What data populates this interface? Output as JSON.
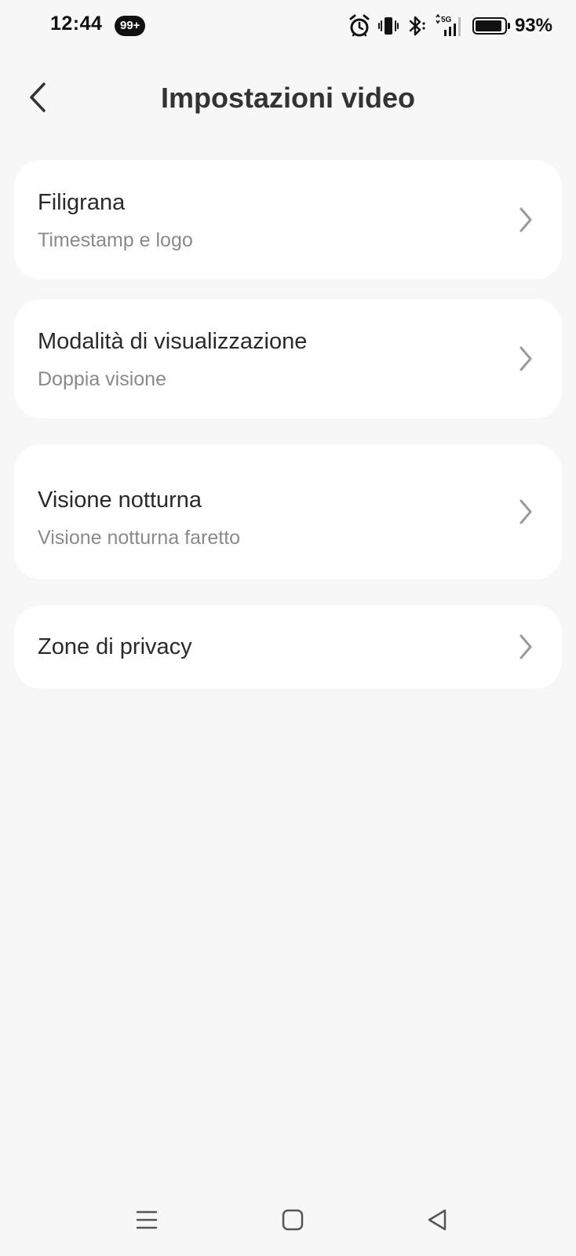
{
  "status_bar": {
    "time": "12:44",
    "notification_badge": "99+",
    "battery_percent": "93%",
    "battery_level": 0.93,
    "network_label": "5G",
    "icons": [
      "alarm-icon",
      "vibrate-icon",
      "bluetooth-icon",
      "signal-icon",
      "battery-icon"
    ]
  },
  "header": {
    "title": "Impostazioni video",
    "back_icon": "chevron-left-icon"
  },
  "settings": [
    {
      "title": "Filigrana",
      "subtitle": "Timestamp e logo"
    },
    {
      "title": "Modalità di visualizzazione",
      "subtitle": "Doppia visione"
    },
    {
      "title": "Visione notturna",
      "subtitle": "Visione notturna faretto"
    },
    {
      "title": "Zone di privacy"
    }
  ],
  "nav_bar": {
    "icons": [
      "menu-icon",
      "home-icon",
      "back-triangle-icon"
    ]
  },
  "colors": {
    "background": "#f7f7f7",
    "card": "#ffffff",
    "title_text": "#2a2a2a",
    "subtitle_text": "#8a8a8a",
    "chevron": "#9a9a9a"
  }
}
